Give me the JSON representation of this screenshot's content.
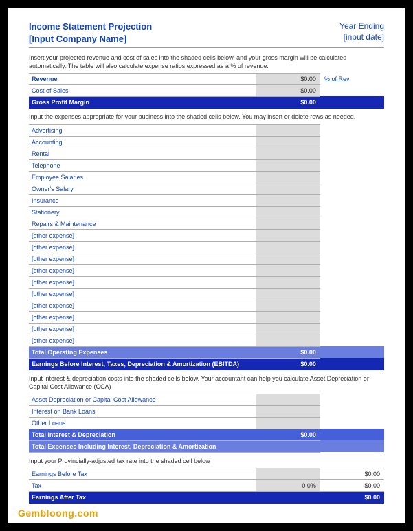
{
  "header": {
    "title_line1": "Income Statement Projection",
    "title_line2": "[Input Company Name]",
    "right_line1": "Year Ending",
    "right_line2": "[input date]"
  },
  "sections": {
    "revenue": {
      "instr": "Insert your projected revenue and cost of sales into the shaded cells below, and your gross margin will be calculated automatically. The table will also calculate expense ratios expressed as a % of revenue.",
      "pct_link": "% of Rev",
      "rows": [
        {
          "label": "Revenue",
          "value": "$0.00",
          "cls": "boldrow",
          "hasPct": true
        },
        {
          "label": "Cost of Sales",
          "value": "$0.00"
        },
        {
          "label": "Gross Profit Margin",
          "value": "$0.00",
          "cls": "navyrow"
        }
      ]
    },
    "expenses": {
      "instr": "Input the expenses appropriate for your business into the shaded cells below. You may insert or delete rows as needed.",
      "rows": [
        {
          "label": "Advertising"
        },
        {
          "label": "Accounting"
        },
        {
          "label": "Rental"
        },
        {
          "label": "Telephone"
        },
        {
          "label": "Employee Salaries"
        },
        {
          "label": "Owner's Salary"
        },
        {
          "label": "Insurance"
        },
        {
          "label": "Stationery"
        },
        {
          "label": "Repairs & Maintenance"
        },
        {
          "label": "[other expense]"
        },
        {
          "label": "[other expense]"
        },
        {
          "label": "[other expense]"
        },
        {
          "label": "[other expense]"
        },
        {
          "label": "[other expense]"
        },
        {
          "label": "[other expense]"
        },
        {
          "label": "[other expense]"
        },
        {
          "label": "[other expense]"
        },
        {
          "label": "[other expense]"
        },
        {
          "label": "[other expense]"
        }
      ],
      "totals": [
        {
          "label": "Total Operating Expenses",
          "value": "$0.00",
          "cls": "lightblue"
        },
        {
          "label": "Earnings Before Interest, Taxes, Depreciation & Amortization (EBITDA)",
          "value": "$0.00",
          "cls": "navyrow"
        }
      ]
    },
    "depreciation": {
      "instr": "Input interest & depreciation costs into the shaded cells below. Your accountant can help you calculate Asset Depreciation or Capital Cost Allowance (CCA)",
      "rows": [
        {
          "label": "Asset Depreciation or Capital Cost Allowance"
        },
        {
          "label": "Interest on Bank Loans"
        },
        {
          "label": "Other Loans"
        }
      ],
      "totals": [
        {
          "label": "Total Interest & Depreciation",
          "value": "$0.00",
          "cls": "medblue"
        },
        {
          "label": "Total Expenses Including Interest, Depreciation & Amortization",
          "value": "",
          "cls": "lightblue"
        }
      ]
    },
    "tax": {
      "instr": "Input your Provincially-adjusted tax rate into the shaded cell below",
      "rows": [
        {
          "label": "Earnings Before Tax",
          "value": "$0.00",
          "white": true
        },
        {
          "label": "Tax",
          "pct": "0.0%",
          "value": "$0.00",
          "white": true
        }
      ],
      "total": {
        "label": "Earnings After Tax",
        "value": "$0.00",
        "cls": "navyrow"
      }
    }
  },
  "watermark": "Gembloong.com"
}
